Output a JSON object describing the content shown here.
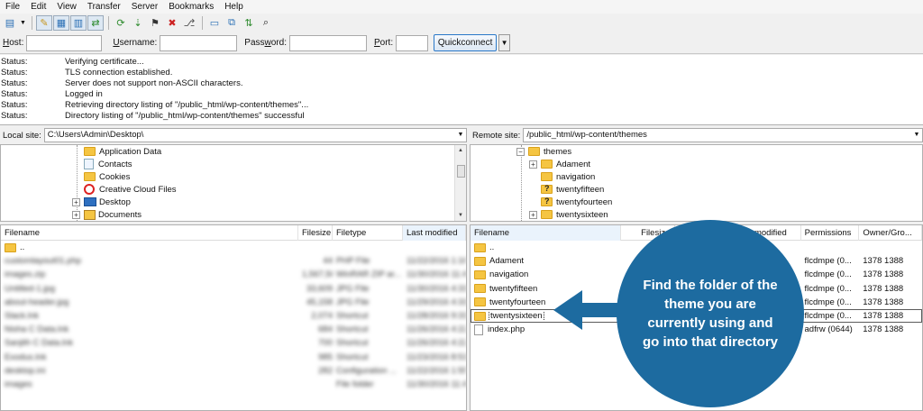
{
  "menu": [
    "File",
    "Edit",
    "View",
    "Transfer",
    "Server",
    "Bookmarks",
    "Help"
  ],
  "quickconnect": {
    "host_label": "Host:",
    "host_key": "H",
    "host_rest": "ost:",
    "user_label": "Username:",
    "user_key": "U",
    "user_rest": "sername:",
    "pass_label": "Password:",
    "pass_pre": "Pass",
    "pass_key": "w",
    "pass_rest": "ord:",
    "port_label": "Port:",
    "port_key": "P",
    "port_rest": "ort:",
    "button": "Quickconnect",
    "host_value": "",
    "username_value": "",
    "password_value": "",
    "port_value": ""
  },
  "log": [
    {
      "k": "Status:",
      "v": "Verifying certificate..."
    },
    {
      "k": "Status:",
      "v": "TLS connection established."
    },
    {
      "k": "Status:",
      "v": "Server does not support non-ASCII characters."
    },
    {
      "k": "Status:",
      "v": "Logged in"
    },
    {
      "k": "Status:",
      "v": "Retrieving directory listing of \"/public_html/wp-content/themes\"..."
    },
    {
      "k": "Status:",
      "v": "Directory listing of \"/public_html/wp-content/themes\" successful"
    }
  ],
  "local": {
    "label": "Local site:",
    "path": "C:\\Users\\Admin\\Desktop\\",
    "tree": [
      "Application Data",
      "Contacts",
      "Cookies",
      "Creative Cloud Files",
      "Desktop",
      "Documents"
    ],
    "headers": {
      "name": "Filename",
      "size": "Filesize",
      "type": "Filetype",
      "modified": "Last modified"
    },
    "files": [
      {
        "name": "..",
        "size": "",
        "type": "",
        "mod": ""
      },
      {
        "name": "customlayout01.php",
        "size": "44",
        "type": "PHP File",
        "mod": "11/22/2016 1:16:..."
      },
      {
        "name": "images.zip",
        "size": "1,567,562",
        "type": "WinRAR ZIP ar...",
        "mod": "11/30/2016 11:41..."
      },
      {
        "name": "Untitled-1.jpg",
        "size": "33,609",
        "type": "JPG File",
        "mod": "11/30/2016 4:31..."
      },
      {
        "name": "about-header.jpg",
        "size": "45,158",
        "type": "JPG File",
        "mod": "11/29/2016 4:31..."
      },
      {
        "name": "Slack.lnk",
        "size": "2,074",
        "type": "Shortcut",
        "mod": "11/28/2016 9:31..."
      },
      {
        "name": "Nisha C Data.lnk",
        "size": "684",
        "type": "Shortcut",
        "mod": "11/26/2016 4:22..."
      },
      {
        "name": "Sanjith C Data.lnk",
        "size": "700",
        "type": "Shortcut",
        "mod": "11/26/2016 4:22..."
      },
      {
        "name": "Exodus.lnk",
        "size": "985",
        "type": "Shortcut",
        "mod": "11/23/2016 8:51..."
      },
      {
        "name": "desktop.ini",
        "size": "282",
        "type": "Configuration ...",
        "mod": "11/22/2016 1:55..."
      },
      {
        "name": "images",
        "size": "",
        "type": "File folder",
        "mod": "11/30/2016 11:41..."
      }
    ]
  },
  "remote": {
    "label": "Remote site:",
    "path": "/public_html/wp-content/themes",
    "tree": [
      "themes",
      "Adament",
      "navigation",
      "twentyfifteen",
      "twentyfourteen",
      "twentysixteen"
    ],
    "headers": {
      "name": "Filename",
      "size": "Filesize",
      "modified": "modified",
      "perms": "Permissions",
      "owner": "Owner/Gro..."
    },
    "files": [
      {
        "name": "..",
        "perms": "",
        "owner": ""
      },
      {
        "name": "Adament",
        "perms": "flcdmpe (0...",
        "owner": "1378 1388"
      },
      {
        "name": "navigation",
        "perms": "flcdmpe (0...",
        "owner": "1378 1388"
      },
      {
        "name": "twentyfifteen",
        "perms": "flcdmpe (0...",
        "owner": "1378 1388"
      },
      {
        "name": "twentyfourteen",
        "perms": "flcdmpe (0...",
        "owner": "1378 1388"
      },
      {
        "name": "twentysixteen",
        "perms": "flcdmpe (0...",
        "owner": "1378 1388"
      },
      {
        "name": "index.php",
        "perms": "adfrw (0644)",
        "owner": "1378 1388"
      }
    ]
  },
  "callout": "Find the folder of the theme you are currently using and go into that directory",
  "colors": {
    "callout": "#1d6ba0",
    "folder": "#f5c542"
  }
}
